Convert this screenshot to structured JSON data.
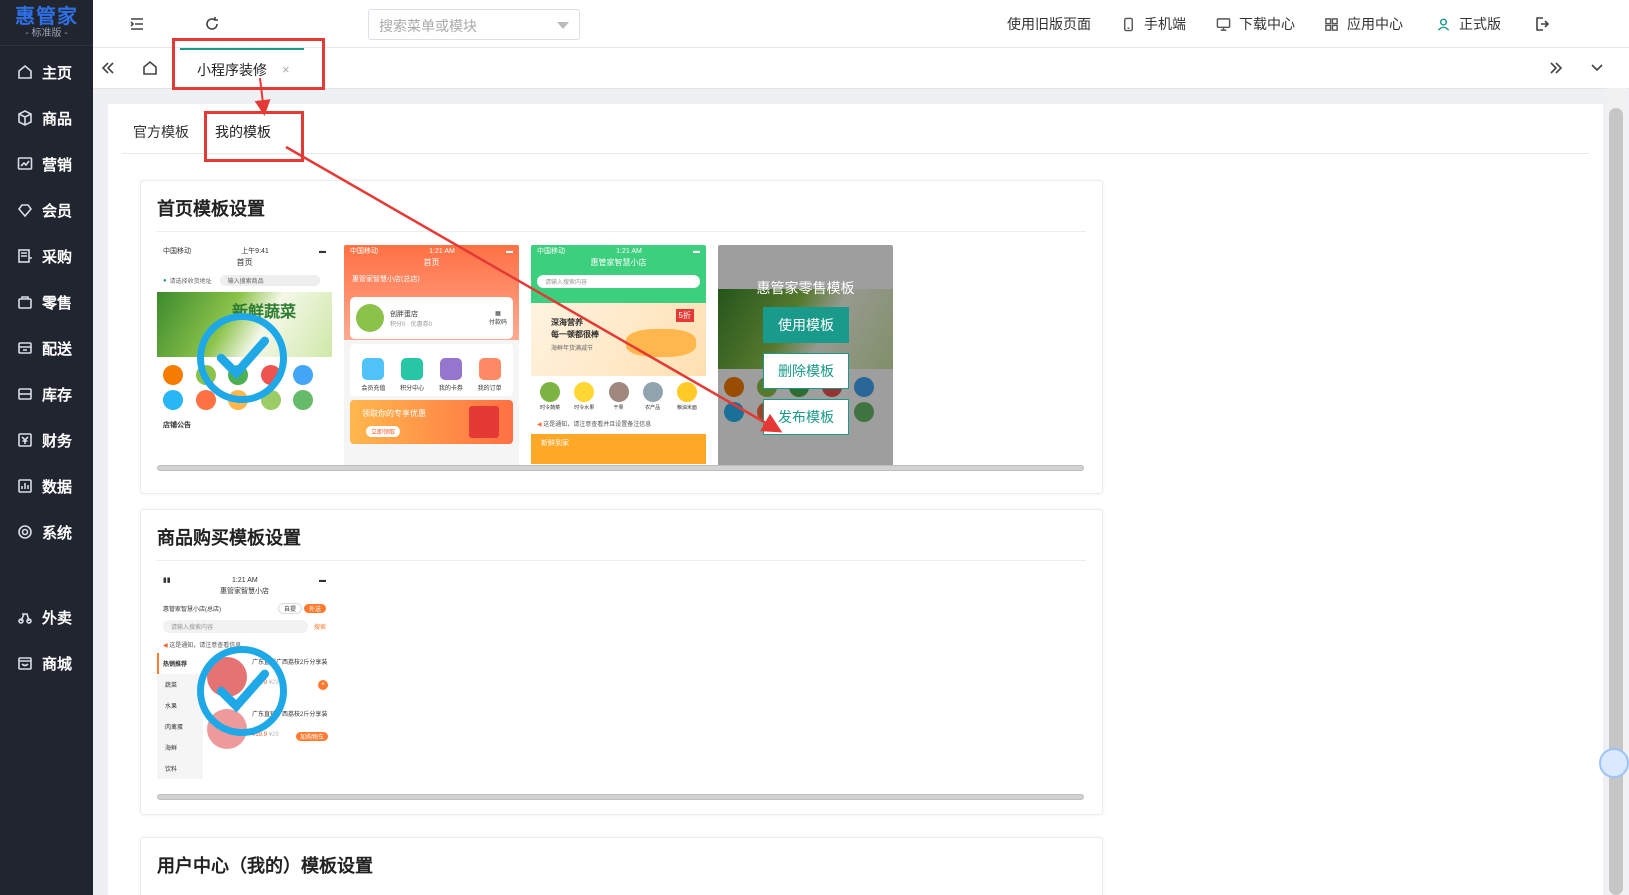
{
  "app": {
    "logo_title": "惠管家",
    "logo_sub": "- 标准版 -"
  },
  "sidebar": {
    "items": [
      {
        "label": "主页",
        "icon": "home-icon"
      },
      {
        "label": "商品",
        "icon": "box-icon"
      },
      {
        "label": "营销",
        "icon": "chart-icon"
      },
      {
        "label": "会员",
        "icon": "diamond-icon"
      },
      {
        "label": "采购",
        "icon": "purchase-icon"
      },
      {
        "label": "零售",
        "icon": "bag-icon"
      },
      {
        "label": "配送",
        "icon": "delivery-icon"
      },
      {
        "label": "库存",
        "icon": "inventory-icon"
      },
      {
        "label": "财务",
        "icon": "finance-icon"
      },
      {
        "label": "数据",
        "icon": "data-icon"
      },
      {
        "label": "系统",
        "icon": "system-icon"
      },
      {
        "label": "外卖",
        "icon": "takeout-icon"
      },
      {
        "label": "商城",
        "icon": "mall-icon"
      }
    ]
  },
  "header": {
    "search_placeholder": "搜索菜单或模块",
    "old_page": "使用旧版页面",
    "mobile": "手机端",
    "download": "下载中心",
    "apps": "应用中心",
    "version": "正式版"
  },
  "tabs": {
    "active_label": "小程序装修",
    "close": "×"
  },
  "subtabs": {
    "official": "官方模板",
    "mine": "我的模板"
  },
  "sections": {
    "home_title": "首页模板设置",
    "buy_title": "商品购买模板设置",
    "user_title": "用户中心（我的）模板设置"
  },
  "thumbs": {
    "t1": {
      "status_left": "中国移动",
      "time": "上午9:41",
      "nav": "首页",
      "address": "请选择收货地址",
      "search": "输入搜索商品",
      "banner": "新鲜蔬菜",
      "notice": "店铺公告"
    },
    "t2": {
      "status_left": "中国移动",
      "time": "1:21 AM",
      "nav": "首页",
      "location": "惠管家智慧小店(总店)",
      "store": "创胖蛋店",
      "store_sub": "积分0 · 优惠券0",
      "qr": "付款码",
      "icons": [
        "会员充值",
        "积分中心",
        "我的卡券",
        "我的订单"
      ],
      "coupon": "领取你的专享优惠",
      "coupon_btn": "立即领取"
    },
    "t3": {
      "status_left": "中国移动",
      "time": "1:21 AM",
      "nav": "惠管家智慧小店",
      "search": "请输入搜索内容",
      "banner_l1": "深海营养",
      "banner_l2": "每一顿都很棒",
      "banner_l3": "海鲜年货满减节",
      "banner_badge": "5折",
      "notice": "这是通知，请注意查看并且设置备注信息",
      "cats": [
        "时令蔬菜",
        "时令水果",
        "干果",
        "农产品",
        "粮油米面"
      ],
      "bottom": "新鲜到家"
    },
    "t4": {
      "overlay_title": "惠管家零售模板",
      "btn_use": "使用模板",
      "btn_delete": "删除模板",
      "btn_publish": "发布模板"
    },
    "b1": {
      "time": "1:21 AM",
      "nav": "惠管家智慧小店",
      "location": "惠管家智慧小店(总店)",
      "tag1": "自提",
      "tag2": "外送",
      "search": "请输入搜索内容",
      "search_btn": "搜索",
      "notice": "这是通知，请注意查看信息",
      "cats": [
        "热销推荐",
        "蔬菜",
        "水果",
        "肉禽蛋",
        "海鲜",
        "饮料"
      ],
      "prod_name": "广东直销广西荔枝2斤分享装",
      "price": "¥19.9",
      "old_price": "¥29",
      "add": "+",
      "btn": "加购物车"
    }
  }
}
